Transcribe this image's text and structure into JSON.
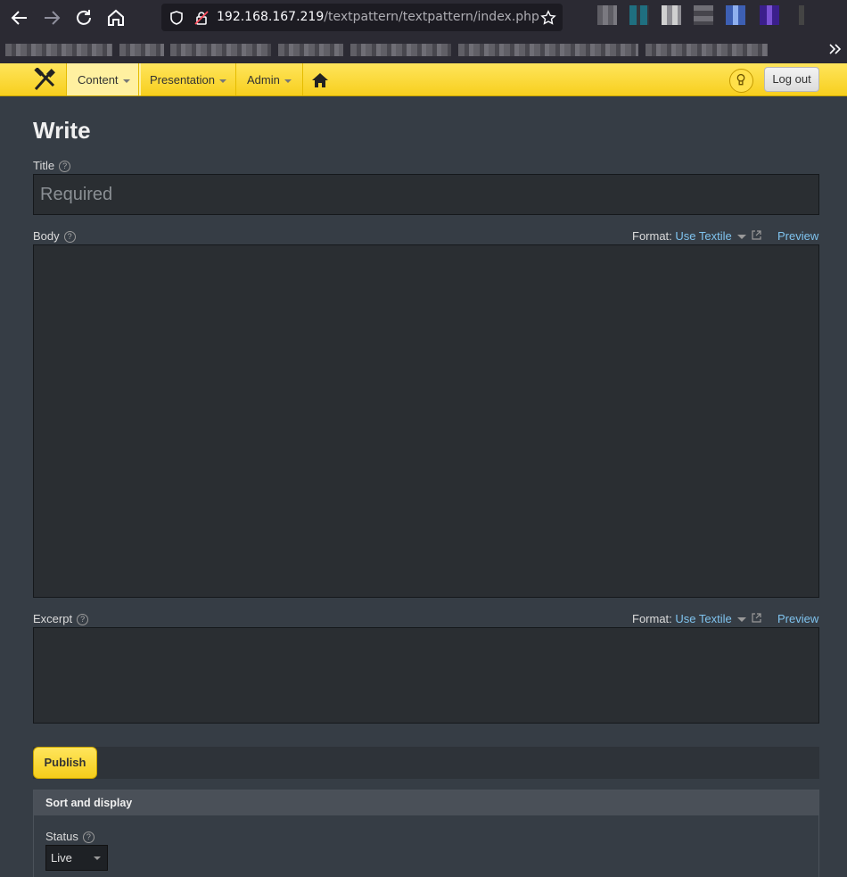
{
  "browser": {
    "url_host": "192.168.167.219",
    "url_path": "/textpattern/textpattern/index.php"
  },
  "nav": {
    "menus": [
      {
        "label": "Content"
      },
      {
        "label": "Presentation"
      },
      {
        "label": "Admin"
      }
    ],
    "logout_label": "Log out"
  },
  "page": {
    "title": "Write",
    "title_field": {
      "label": "Title",
      "placeholder": "Required",
      "value": ""
    },
    "body_field": {
      "label": "Body",
      "format_label": "Format:",
      "format_value": "Use Textile",
      "preview_label": "Preview"
    },
    "excerpt_field": {
      "label": "Excerpt",
      "format_label": "Format:",
      "format_value": "Use Textile",
      "preview_label": "Preview"
    },
    "publish_label": "Publish",
    "sort_display": {
      "heading": "Sort and display",
      "status_label": "Status",
      "status_value": "Live"
    }
  },
  "icons": {
    "help": "?",
    "bulb": "bulb-icon"
  }
}
